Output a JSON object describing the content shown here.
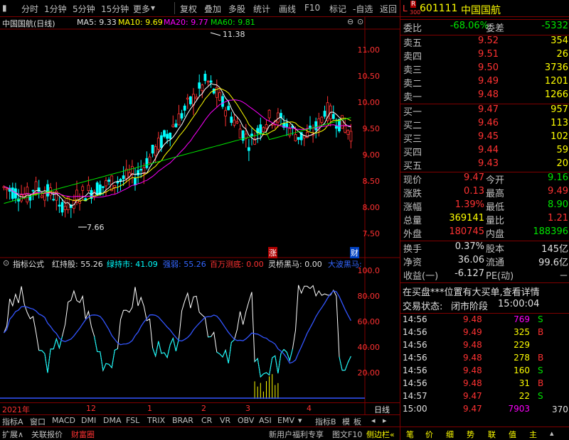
{
  "toolbar": {
    "items": [
      "分时",
      "1分钟",
      "5分钟",
      "15分钟",
      "更多",
      "复权",
      "叠加",
      "多股",
      "统计",
      "画线",
      "F10",
      "标记",
      "-自选",
      "返回"
    ]
  },
  "main_info": {
    "name": "中国国航(日线)",
    "ma5": "MA5: 9.33",
    "ma10": "MA10: 9.69",
    "ma20": "MA20: 9.77",
    "ma60": "MA60: 9.81"
  },
  "y_axis": [
    "11.00",
    "10.50",
    "10.00",
    "9.50",
    "9.00",
    "8.50",
    "8.00",
    "7.50"
  ],
  "annotations": {
    "high": "11.38",
    "low": "7.66",
    "zhang": "涨",
    "cai": "财"
  },
  "indicator": {
    "title": "指标公式",
    "hcg": "红持股: 55.26",
    "lcs": "绿持市: 41.09",
    "qr": "强弱: 55.26",
    "bwcd": "百万测底: 0.00",
    "lqhm": "灵桥黑马: 0.00",
    "dbhm": "大波黑马: "
  },
  "ind_axis": [
    "100.0",
    "80.00",
    "60.00",
    "40.00",
    "20.00"
  ],
  "x_axis": {
    "year": "2021年",
    "m12": "12",
    "m1": "1",
    "m2": "2",
    "m3": "3",
    "m4": "4",
    "right": "日线"
  },
  "tabs1": [
    "指标A",
    "窗口",
    "MACD",
    "DMI",
    "DMA",
    "FSL",
    "TRIX",
    "BRAR",
    "CR",
    "VR",
    "OBV",
    "ASI",
    "EMV",
    "指标B",
    "模",
    "板"
  ],
  "tabs2": [
    "扩展∧",
    "关联报价",
    "财富圈",
    "新用户福利专享",
    "图文F10",
    "侧边栏«",
    "笔",
    "价",
    "细",
    "势",
    "联",
    "值",
    "主"
  ],
  "stock": {
    "code": "601111",
    "name": "中国国航",
    "badge_l": "L",
    "badge_r": "R",
    "badge_n": "300"
  },
  "weibi": {
    "label": "委比",
    "value": "-68.06%",
    "label2": "委差",
    "value2": "-5332"
  },
  "sell": [
    {
      "l": "卖五",
      "p": "9.52",
      "v": "354"
    },
    {
      "l": "卖四",
      "p": "9.51",
      "v": "26"
    },
    {
      "l": "卖三",
      "p": "9.50",
      "v": "3736"
    },
    {
      "l": "卖二",
      "p": "9.49",
      "v": "1201"
    },
    {
      "l": "卖一",
      "p": "9.48",
      "v": "1266"
    }
  ],
  "buy": [
    {
      "l": "买一",
      "p": "9.47",
      "v": "957"
    },
    {
      "l": "买二",
      "p": "9.46",
      "v": "113"
    },
    {
      "l": "买三",
      "p": "9.45",
      "v": "102"
    },
    {
      "l": "买四",
      "p": "9.44",
      "v": "59"
    },
    {
      "l": "买五",
      "p": "9.43",
      "v": "20"
    }
  ],
  "quote": [
    {
      "l1": "现价",
      "v1": "9.47",
      "l2": "今开",
      "v2": "9.16"
    },
    {
      "l1": "涨跌",
      "v1": "0.13",
      "l2": "最高",
      "v2": "9.49"
    },
    {
      "l1": "涨幅",
      "v1": "1.39%",
      "l2": "最低",
      "v2": "8.90"
    },
    {
      "l1": "总量",
      "v1": "369141",
      "l2": "量比",
      "v2": "1.21"
    },
    {
      "l1": "外盘",
      "v1": "180745",
      "l2": "内盘",
      "v2": "188396"
    }
  ],
  "stats": [
    {
      "l1": "换手",
      "v1": "0.37%",
      "l2": "股本",
      "v2": "145亿"
    },
    {
      "l1": "净资",
      "v1": "36.06",
      "l2": "流通",
      "v2": "99.6亿"
    },
    {
      "l1": "收益(一)",
      "v1": "-6.127",
      "l2": "PE(动)",
      "v2": "－"
    }
  ],
  "notice": "在买盘***位置有大买单,查看详情",
  "status": {
    "label": "交易状态:",
    "value": "闭市阶段",
    "time": "15:00:04"
  },
  "trades": [
    {
      "t": "14:56",
      "p": "9.48",
      "v": "769",
      "f": "S"
    },
    {
      "t": "14:56",
      "p": "9.49",
      "v": "325",
      "f": "B"
    },
    {
      "t": "14:56",
      "p": "9.48",
      "v": "229",
      "f": ""
    },
    {
      "t": "14:56",
      "p": "9.48",
      "v": "278",
      "f": "B"
    },
    {
      "t": "14:56",
      "p": "9.48",
      "v": "160",
      "f": "S"
    },
    {
      "t": "14:56",
      "p": "9.48",
      "v": "31",
      "f": "B"
    },
    {
      "t": "14:57",
      "p": "9.47",
      "v": "22",
      "f": "S"
    },
    {
      "t": "15:00",
      "p": "9.47",
      "v": "7903",
      "f": ""
    }
  ],
  "trade_last_extra": "370"
}
